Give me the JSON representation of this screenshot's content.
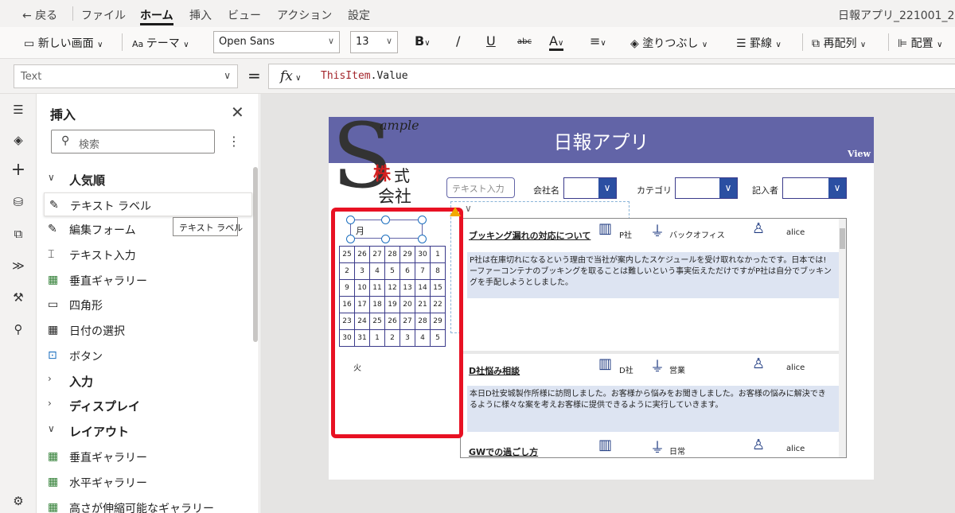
{
  "menubar": {
    "back": "戻る",
    "file": "ファイル",
    "home": "ホーム",
    "insert": "挿入",
    "view": "ビュー",
    "action": "アクション",
    "settings": "設定",
    "app_name": "日報アプリ_221001_2"
  },
  "ribbon": {
    "new_screen": "新しい画面",
    "theme": "テーマ",
    "font": "Open Sans",
    "font_size": "13",
    "bold": "B",
    "italic": "/",
    "underline": "U",
    "strike": "abc",
    "font_color": "A",
    "fill": "塗りつぶし",
    "border": "罫線",
    "reorder": "再配列",
    "align": "配置"
  },
  "formula_bar": {
    "property": "Text",
    "equals": "=",
    "fx": "fx",
    "formula_keyword": "ThisItem",
    "formula_rest": ".Value"
  },
  "rail": {
    "icons": [
      "menu-icon",
      "layers-icon",
      "plus-icon",
      "database-icon",
      "media-icon",
      "power-automate-icon",
      "tools-icon",
      "search-icon",
      "settings-icon"
    ]
  },
  "insert_panel": {
    "title": "挿入",
    "search_placeholder": "検索",
    "sections": [
      {
        "label": "人気順",
        "type": "header"
      },
      {
        "label": "テキスト ラベル",
        "type": "item"
      },
      {
        "label": "編集フォーム",
        "type": "item"
      },
      {
        "label": "テキスト入力",
        "type": "item"
      },
      {
        "label": "垂直ギャラリー",
        "type": "item"
      },
      {
        "label": "四角形",
        "type": "item"
      },
      {
        "label": "日付の選択",
        "type": "item"
      },
      {
        "label": "ボタン",
        "type": "item"
      },
      {
        "label": "入力",
        "type": "header"
      },
      {
        "label": "ディスプレイ",
        "type": "header"
      },
      {
        "label": "レイアウト",
        "type": "header"
      },
      {
        "label": "垂直ギャラリー",
        "type": "item"
      },
      {
        "label": "水平ギャラリー",
        "type": "item"
      },
      {
        "label": "高さが伸縮可能なギャラリー",
        "type": "item"
      }
    ],
    "tooltip": "テキスト ラベル"
  },
  "app_screen": {
    "header_title": "日報アプリ",
    "view_label": "View",
    "logo": {
      "letter": "S",
      "ample": "ample",
      "kabu": "株",
      "shiki": "式",
      "kaisha": "会社"
    },
    "text_input_placeholder": "テキスト入力",
    "filters": [
      {
        "label": "会社名"
      },
      {
        "label": "カテゴリ"
      },
      {
        "label": "記入者"
      }
    ],
    "date_picker": {
      "value": "月",
      "weekday_label": "火",
      "weeks": [
        [
          "25",
          "26",
          "27",
          "28",
          "29",
          "30",
          "1"
        ],
        [
          "2",
          "3",
          "4",
          "5",
          "6",
          "7",
          "8"
        ],
        [
          "9",
          "10",
          "11",
          "12",
          "13",
          "14",
          "15"
        ],
        [
          "16",
          "17",
          "18",
          "19",
          "20",
          "21",
          "22"
        ],
        [
          "23",
          "24",
          "25",
          "26",
          "27",
          "28",
          "29"
        ],
        [
          "30",
          "31",
          "1",
          "2",
          "3",
          "4",
          "5"
        ]
      ]
    },
    "gallery": [
      {
        "title": "ブッキング漏れの対応について",
        "company": "P社",
        "category": "バックオフィス",
        "author": "alice",
        "body_line1": "P社は在庫切れになるという理由で当社が案内したスケジュールを受け取れなかったです。日本では!",
        "body_line2": "ーファーコンテナのブッキングを取ることは難しいという事実伝えただけですがP社は自分でブッキン",
        "body_line3": "グを手配しようとしました。"
      },
      {
        "title": "D社悩み相談",
        "company": "D社",
        "category": "営業",
        "author": "alice",
        "body_line1": "本日D社安城製作所様に訪問しました。お客様から悩みをお聞きしました。お客様の悩みに解決でき",
        "body_line2": "るように様々な案を考えお客様に提供できるように実行していきます。",
        "body_line3": ""
      },
      {
        "title": "GWでの過ごし方",
        "company": "",
        "category": "日常",
        "author": "alice",
        "body_line1": "",
        "body_line2": "",
        "body_line3": ""
      }
    ]
  },
  "colors": {
    "header_purple": "#6264a7",
    "dropdown_blue": "#2b4fa2",
    "highlight_red": "#e81123",
    "formula_keyword": "#a4262c"
  }
}
